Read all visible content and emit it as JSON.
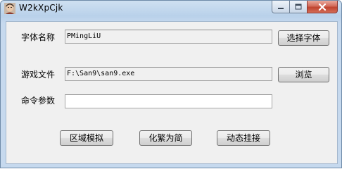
{
  "window": {
    "title": "W2kXpCjk",
    "minimize_icon": "minimize-icon",
    "maximize_icon": "maximize-icon",
    "close_icon": "close-icon"
  },
  "form": {
    "font_name_label": "字体名称",
    "font_name_value": "PMingLiU",
    "select_font_button": "选择字体",
    "game_file_label": "游戏文件",
    "game_file_value": "F:\\San9\\san9.exe",
    "browse_button": "浏览",
    "params_label": "命令参数",
    "params_value": ""
  },
  "actions": {
    "region_sim_button": "区域模拟",
    "trad_to_simp_button": "化繁为简",
    "dynamic_hook_button": "动态挂接"
  },
  "colors": {
    "titlebar": "#b9d1ea",
    "client_bg": "#f0f0f0",
    "close_button": "#c8503a"
  }
}
